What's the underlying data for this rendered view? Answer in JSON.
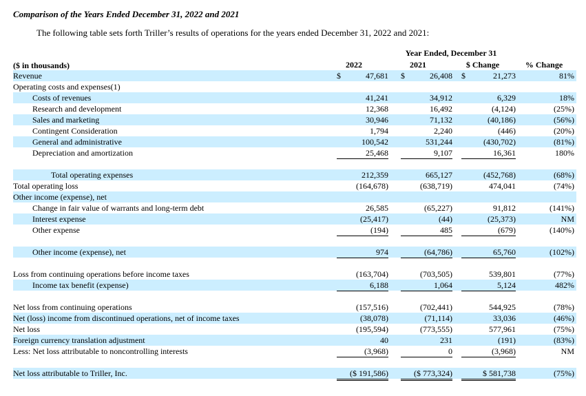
{
  "heading": "Comparison of the Years Ended December 31, 2022 and 2021",
  "intro": "The following table sets forth Triller’s results of operations for the years ended December 31, 2022 and 2021:",
  "header": {
    "group": "Year Ended, December 31",
    "units": "($ in thousands)",
    "col_2022": "2022",
    "col_2021": "2021",
    "col_change": "$ Change",
    "col_pct": "% Change"
  },
  "rows": [
    {
      "label": "Revenue",
      "indent": 0,
      "shade": true,
      "v2022": "47,681",
      "v2021": "26,408",
      "change": "21,273",
      "pct": "81%",
      "dollar": true
    },
    {
      "label": "Operating costs and expenses(1)",
      "indent": 0,
      "shade": false,
      "v2022": "",
      "v2021": "",
      "change": "",
      "pct": ""
    },
    {
      "label": "Costs of revenues",
      "indent": 1,
      "shade": true,
      "v2022": "41,241",
      "v2021": "34,912",
      "change": "6,329",
      "pct": "18%"
    },
    {
      "label": "Research and development",
      "indent": 1,
      "shade": false,
      "v2022": "12,368",
      "v2021": "16,492",
      "change": "(4,124)",
      "pct": "(25%)"
    },
    {
      "label": "Sales and marketing",
      "indent": 1,
      "shade": true,
      "v2022": "30,946",
      "v2021": "71,132",
      "change": "(40,186)",
      "pct": "(56%)"
    },
    {
      "label": "Contingent Consideration",
      "indent": 1,
      "shade": false,
      "v2022": "1,794",
      "v2021": "2,240",
      "change": "(446)",
      "pct": "(20%)"
    },
    {
      "label": "General and administrative",
      "indent": 1,
      "shade": true,
      "v2022": "100,542",
      "v2021": "531,244",
      "change": "(430,702)",
      "pct": "(81%)"
    },
    {
      "label": "Depreciation and amortization",
      "indent": 1,
      "shade": false,
      "v2022": "25,468",
      "v2021": "9,107",
      "change": "16,361",
      "pct": "180%",
      "underline": true
    },
    {
      "gap": true
    },
    {
      "label": "Total operating expenses",
      "indent": 2,
      "shade": true,
      "v2022": "212,359",
      "v2021": "665,127",
      "change": "(452,768)",
      "pct": "(68%)"
    },
    {
      "label": "Total operating loss",
      "indent": 0,
      "shade": false,
      "v2022": "(164,678)",
      "v2021": "(638,719)",
      "change": "474,041",
      "pct": "(74%)"
    },
    {
      "label": "Other income (expense), net",
      "indent": 0,
      "shade": true,
      "v2022": "",
      "v2021": "",
      "change": "",
      "pct": ""
    },
    {
      "label": "Change in fair value of warrants and long-term debt",
      "indent": 1,
      "shade": false,
      "v2022": "26,585",
      "v2021": "(65,227)",
      "change": "91,812",
      "pct": "(141%)"
    },
    {
      "label": "Interest expense",
      "indent": 1,
      "shade": true,
      "v2022": "(25,417)",
      "v2021": "(44)",
      "change": "(25,373)",
      "pct": "NM"
    },
    {
      "label": "Other expense",
      "indent": 1,
      "shade": false,
      "v2022": "(194)",
      "v2021": "485",
      "change": "(679)",
      "pct": "(140%)",
      "underline": true
    },
    {
      "gap": true
    },
    {
      "label": "Other income (expense), net",
      "indent": 1,
      "shade": true,
      "v2022": "974",
      "v2021": "(64,786)",
      "change": "65,760",
      "pct": "(102%)",
      "underline": true
    },
    {
      "gap": true
    },
    {
      "label": "Loss from continuing operations before income taxes",
      "indent": 0,
      "shade": false,
      "v2022": "(163,704)",
      "v2021": "(703,505)",
      "change": "539,801",
      "pct": "(77%)"
    },
    {
      "label": "Income tax benefit (expense)",
      "indent": 1,
      "shade": true,
      "v2022": "6,188",
      "v2021": "1,064",
      "change": "5,124",
      "pct": "482%",
      "underline": true
    },
    {
      "gap": true
    },
    {
      "label": "Net loss from continuing operations",
      "indent": 0,
      "shade": false,
      "v2022": "(157,516)",
      "v2021": "(702,441)",
      "change": "544,925",
      "pct": "(78%)"
    },
    {
      "label": "Net (loss) income from discontinued operations, net of income taxes",
      "indent": 0,
      "shade": true,
      "v2022": "(38,078)",
      "v2021": "(71,114)",
      "change": "33,036",
      "pct": "(46%)"
    },
    {
      "label": "Net loss",
      "indent": 0,
      "shade": false,
      "v2022": "(195,594)",
      "v2021": "(773,555)",
      "change": "577,961",
      "pct": "(75%)"
    },
    {
      "label": "Foreign currency translation adjustment",
      "indent": 0,
      "shade": true,
      "v2022": "40",
      "v2021": "231",
      "change": "(191)",
      "pct": "(83%)"
    },
    {
      "label": "Less: Net loss attributable to noncontrolling interests",
      "indent": 0,
      "shade": false,
      "v2022": "(3,968)",
      "v2021": "0",
      "change": "(3,968)",
      "pct": "NM",
      "underline": true
    },
    {
      "gap": true
    },
    {
      "label": "Net loss attributable to Triller, Inc.",
      "indent": 0,
      "shade": true,
      "v2022": "($ 191,586)",
      "v2021": "($ 773,324)",
      "change": "$ 581,738",
      "pct": "(75%)",
      "double": true
    }
  ]
}
